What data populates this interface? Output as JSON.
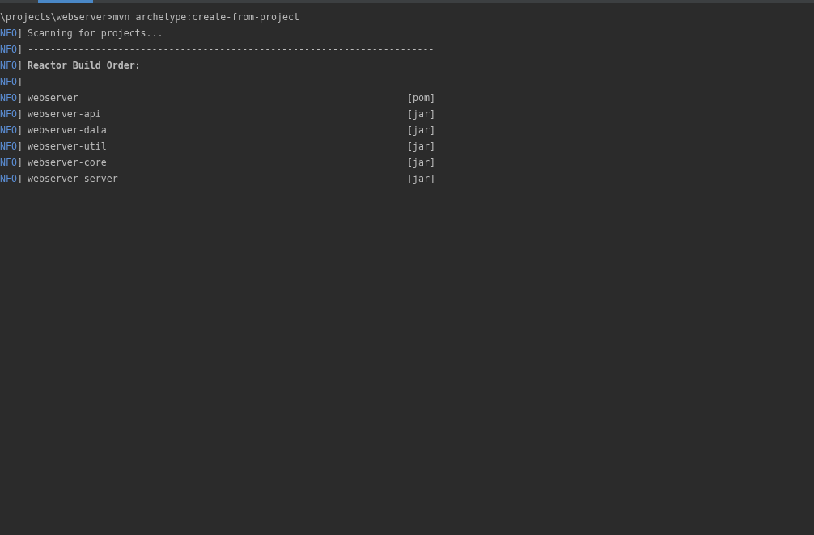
{
  "command_line": "\\projects\\webserver>mvn archetype:create-from-project",
  "lines": [
    {
      "level": "NFO",
      "bracket": "]",
      "kind": "plain",
      "text": "Scanning for projects..."
    },
    {
      "level": "NFO",
      "bracket": "]",
      "kind": "plain",
      "text": "------------------------------------------------------------------------"
    },
    {
      "level": "NFO",
      "bracket": "]",
      "kind": "bold",
      "text": "Reactor Build Order:"
    },
    {
      "level": "NFO",
      "bracket": "]",
      "kind": "blank"
    },
    {
      "level": "NFO",
      "bracket": "]",
      "kind": "module",
      "text": "webserver",
      "packaging": "[pom]"
    },
    {
      "level": "NFO",
      "bracket": "]",
      "kind": "module",
      "text": "webserver-api",
      "packaging": "[jar]"
    },
    {
      "level": "NFO",
      "bracket": "]",
      "kind": "module",
      "text": "webserver-data",
      "packaging": "[jar]"
    },
    {
      "level": "NFO",
      "bracket": "]",
      "kind": "module",
      "text": "webserver-util",
      "packaging": "[jar]"
    },
    {
      "level": "NFO",
      "bracket": "]",
      "kind": "module",
      "text": "webserver-core",
      "packaging": "[jar]"
    },
    {
      "level": "NFO",
      "bracket": "]",
      "kind": "module",
      "text": "webserver-server",
      "packaging": "[jar]"
    }
  ]
}
